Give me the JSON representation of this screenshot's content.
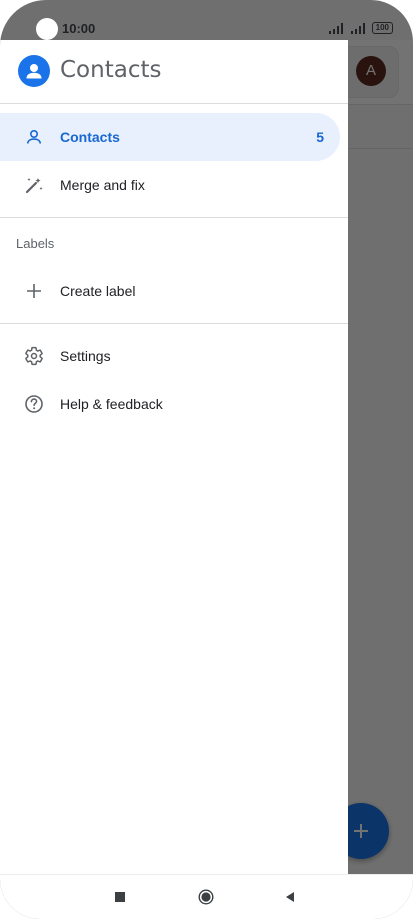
{
  "status_bar": {
    "time": "10:00",
    "battery": "100"
  },
  "background_app": {
    "avatar_letter": "A"
  },
  "drawer": {
    "app_title": "Contacts",
    "items": [
      {
        "label": "Contacts",
        "count": "5",
        "icon": "person-icon",
        "active": true
      },
      {
        "label": "Merge and fix",
        "icon": "magic-wand-icon",
        "active": false
      }
    ],
    "labels_section": {
      "heading": "Labels",
      "create_label": "Create label"
    },
    "footer_items": [
      {
        "label": "Settings",
        "icon": "gear-icon"
      },
      {
        "label": "Help & feedback",
        "icon": "help-circle-icon"
      }
    ]
  },
  "colors": {
    "accent": "#1a73e8",
    "active_bg": "#e8f0fe",
    "active_text": "#1967d2"
  }
}
